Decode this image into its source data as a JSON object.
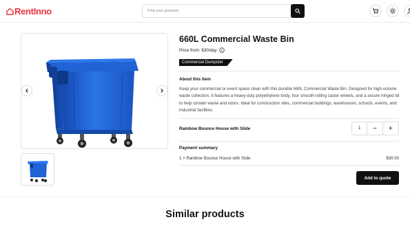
{
  "header": {
    "logo_text": "RentInno",
    "brand_color": "#e8343f",
    "search_placeholder": "Find your products",
    "icons": [
      "search-icon",
      "cart-icon",
      "theme-sun-icon",
      "user-icon"
    ]
  },
  "gallery": {
    "image_subject": "blue 660L wheeled waste bin",
    "bin_color": "#1f63d6",
    "prev_icon": "chevron-left-icon",
    "next_icon": "chevron-right-icon",
    "thumbnail_count": 1
  },
  "product": {
    "title": "660L Commercial Waste Bin",
    "price_label": "Price from: $30/day",
    "category_tag": "Commercial Dumpster",
    "about_heading": "About this item",
    "description": "Keep your commercial or event space clean with this durable 660L Commercial Waste Bin. Designed for high-volume waste collection, it features a heavy-duty polyethylene body, four smooth-rolling caster wheels, and a secure hinged lid to help contain waste and odors. Ideal for construction sites, commercial buildings, warehouses, schools, events, and industrial facilities."
  },
  "selection": {
    "item_name": "Rainbow Bounce House with Slide",
    "quantity": "1",
    "minus_label": "−",
    "plus_label": "+"
  },
  "summary": {
    "heading": "Payment summary",
    "line_label": "1 × Rainbow Bounce House with Slide",
    "line_amount": "$30.00"
  },
  "actions": {
    "add_to_quote": "Add to quote"
  },
  "similar": {
    "heading": "Similar products"
  }
}
